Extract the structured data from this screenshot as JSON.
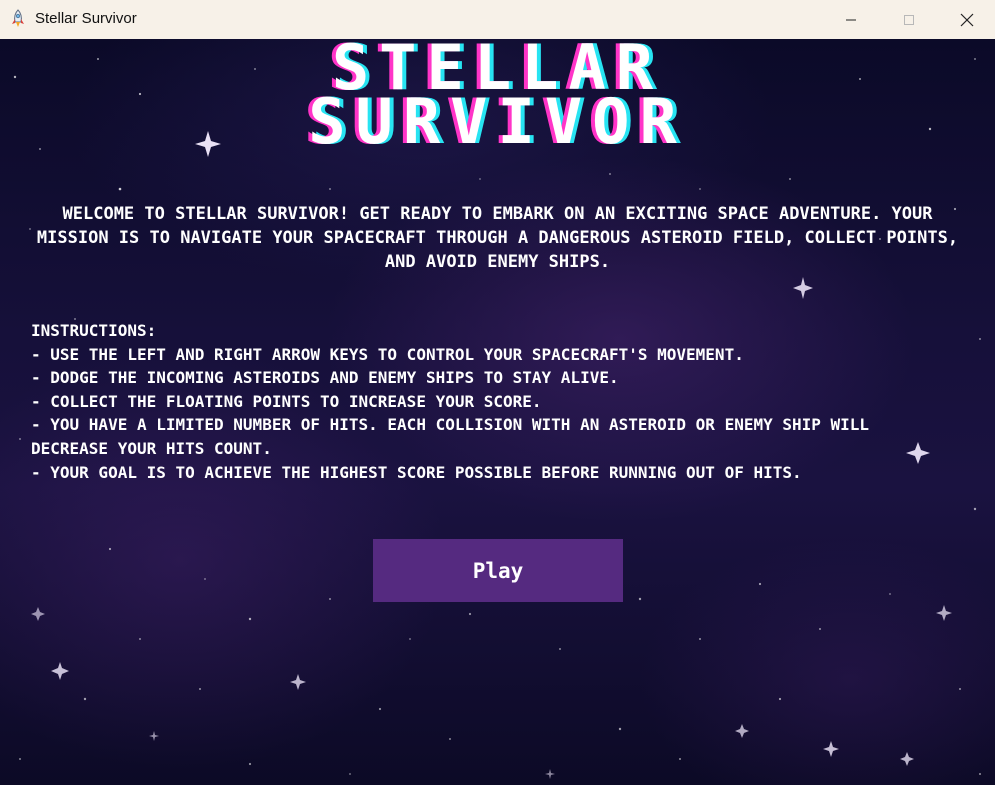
{
  "window": {
    "title": "Stellar Survivor",
    "icon": "rocket-icon",
    "controls": [
      "minimize-icon",
      "maximize-icon",
      "close-icon"
    ]
  },
  "game": {
    "title_line1": "STELLAR",
    "title_line2": "SURVIVOR",
    "welcome": "WELCOME TO STELLAR SURVIVOR! GET READY TO EMBARK ON AN EXCITING SPACE ADVENTURE. YOUR MISSION IS TO NAVIGATE YOUR SPACECRAFT THROUGH A DANGEROUS ASTEROID FIELD, COLLECT POINTS, AND AVOID ENEMY SHIPS.",
    "instructions": [
      "INSTRUCTIONS:",
      "- USE THE LEFT AND RIGHT ARROW KEYS TO CONTROL YOUR SPACECRAFT'S MOVEMENT.",
      "- DODGE THE INCOMING ASTEROIDS AND ENEMY SHIPS TO STAY ALIVE.",
      "- COLLECT THE FLOATING POINTS TO INCREASE YOUR SCORE.",
      "- YOU HAVE A LIMITED NUMBER OF HITS. EACH COLLISION WITH AN ASTEROID OR ENEMY SHIP WILL DECREASE YOUR HITS COUNT.",
      "- YOUR GOAL IS TO ACHIEVE THE HIGHEST SCORE POSSIBLE BEFORE RUNNING OUT OF HITS."
    ],
    "play_label": "Play"
  },
  "colors": {
    "background": "#0d0a2a",
    "title_shadow_magenta": "#ff34c8",
    "title_shadow_cyan": "#27e4f2",
    "play_button": "#552a80",
    "titlebar": "#f7f1e8"
  }
}
